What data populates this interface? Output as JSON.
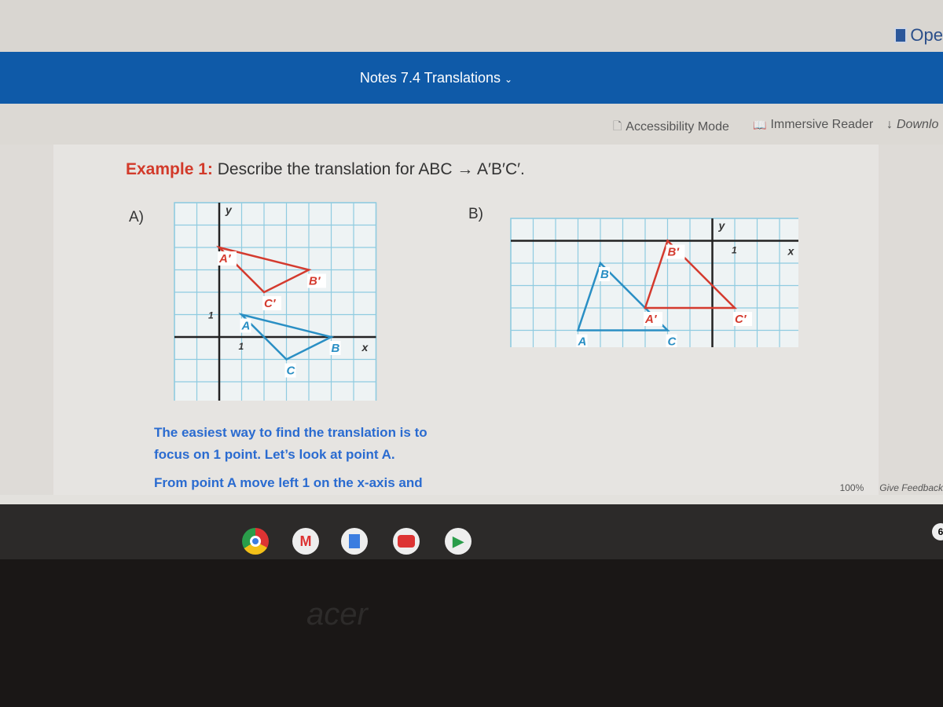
{
  "header": {
    "open_label": "Ope",
    "doc_title": "Notes 7.4 Translations",
    "title_chevron": "chevron-down-icon"
  },
  "toolbar": {
    "accessibility": "Accessibility Mode",
    "immersive": "Immersive Reader",
    "download": "Downlo"
  },
  "document": {
    "example_label": "Example 1:",
    "example_text": "Describe the translation for ABC → A′B′C′.",
    "part_a": "A)",
    "part_b": "B)",
    "explain1": "The easiest way to find the translation is to",
    "explain2": "focus on 1 point.  Let’s look at point A.",
    "explain3": "From point A move left 1 on the x-axis and"
  },
  "status": {
    "zoom": "100%",
    "feedback": "Give Feedback"
  },
  "shelf": {
    "apps": [
      "chrome",
      "gmail",
      "docs",
      "youtube",
      "play-store"
    ],
    "badge": "6"
  },
  "bezel": {
    "brand": "acer"
  },
  "colors": {
    "original": "#2a8fc4",
    "image": "#d43a2e",
    "grid": "#8fcbe0",
    "accent": "#0f5aa8"
  },
  "chart_data": [
    {
      "type": "scatter",
      "xlim": [
        -2,
        7
      ],
      "ylim": [
        -3,
        6
      ],
      "grid": true,
      "xlabel": "x",
      "ylabel": "y",
      "tick_labels": {
        "x": "1",
        "y": "1"
      },
      "original": {
        "A": [
          1,
          1
        ],
        "B": [
          5,
          0
        ],
        "C": [
          3,
          -1
        ]
      },
      "image": {
        "A′": [
          0,
          4
        ],
        "B′": [
          4,
          3
        ],
        "C′": [
          2,
          2
        ]
      }
    },
    {
      "type": "scatter",
      "xlim": [
        -9,
        4
      ],
      "ylim": [
        -5,
        1
      ],
      "grid": true,
      "xlabel": "x",
      "ylabel": "y",
      "tick_labels": {
        "x": "1"
      },
      "original": {
        "A": [
          -6,
          -4
        ],
        "B": [
          -5,
          -1
        ],
        "C": [
          -2,
          -4
        ]
      },
      "image": {
        "A′": [
          -3,
          -3
        ],
        "B′": [
          -2,
          0
        ],
        "C′": [
          1,
          -3
        ]
      }
    }
  ]
}
